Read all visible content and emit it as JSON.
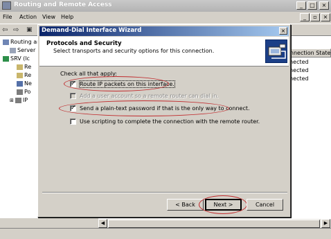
{
  "window": {
    "title": "Routing and Remote Access"
  },
  "menu": {
    "file": "File",
    "action": "Action",
    "view": "View",
    "help": "Help"
  },
  "tree": {
    "items": [
      "Routing an",
      "Server",
      "SRV (lc",
      "Re",
      "Re",
      "Ne",
      "Po",
      "IP"
    ]
  },
  "list": {
    "column_header": "onnection State",
    "rows": [
      "nnected",
      "nnected",
      "nnected"
    ]
  },
  "dialog": {
    "title": "Demand-Dial Interface Wizard",
    "close_glyph": "×",
    "header_title": "Protocols and Security",
    "header_subtitle": "Select transports and security options for this connection.",
    "instruction": "Check all that apply:",
    "options": [
      {
        "label": "Route IP packets on this interface.",
        "checked": true,
        "enabled": true
      },
      {
        "label": "Add a user account so a remote router can dial in.",
        "checked": false,
        "enabled": false
      },
      {
        "label": "Send a plain-text password if that is the only way to connect.",
        "checked": true,
        "enabled": true
      },
      {
        "label": "Use scripting to complete the connection with the remote router.",
        "checked": false,
        "enabled": true
      }
    ],
    "buttons": {
      "back": "< Back",
      "next": "Next >",
      "cancel": "Cancel"
    }
  },
  "colors": {
    "annotation": "#c0292c",
    "dialog_title_start": "#0a246a",
    "dialog_title_end": "#a6caf0",
    "face": "#d4d0c8"
  }
}
